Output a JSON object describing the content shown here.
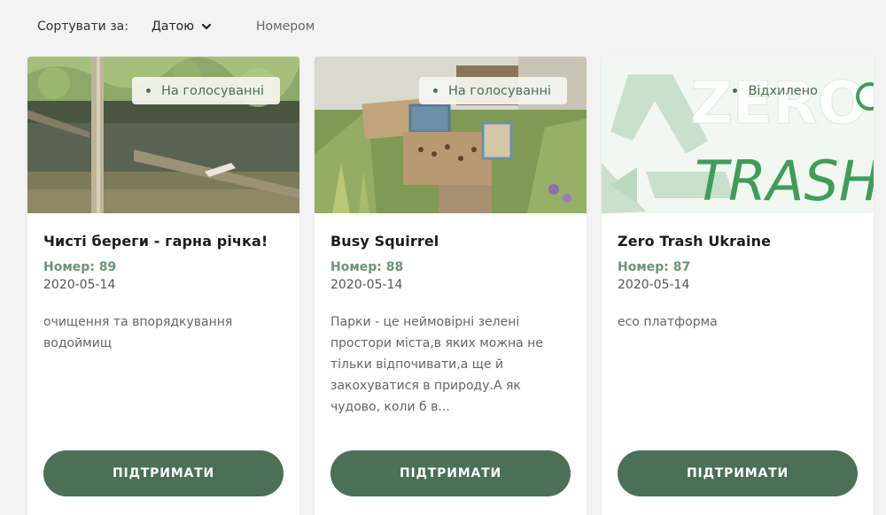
{
  "sort": {
    "label": "Сортувати за:",
    "options": [
      {
        "label": "Датою",
        "selected": true
      },
      {
        "label": "Номером",
        "selected": false
      }
    ]
  },
  "cards": [
    {
      "status": "На голосуванні",
      "title": "Чисті береги - гарна річка!",
      "number": "Номер: 89",
      "date": "2020-05-14",
      "description": "очищення та впорядкування водоймищ",
      "button": "ПІДТРИМАТИ"
    },
    {
      "status": "На голосуванні",
      "title": "Busy Squirrel",
      "number": "Номер: 88",
      "date": "2020-05-14",
      "description": "Парки - це неймовірні зелені простори міста,в яких можна не тільки відпочивати,а ще й закохуватися в природу.А як чудово, коли б в...",
      "button": "ПІДТРИМАТИ"
    },
    {
      "status": "Відхилено",
      "title": "Zero Trash Ukraine",
      "number": "Номер: 87",
      "date": "2020-05-14",
      "description": "eco платформа",
      "button": "ПІДТРИМАТИ",
      "image_text": {
        "top": "ZERO",
        "bottom": "TRASH"
      }
    }
  ],
  "colors": {
    "accent": "#4b6f57",
    "number_green": "#6d9379",
    "status_green": "#4a7058",
    "background": "#f3f3f3"
  }
}
